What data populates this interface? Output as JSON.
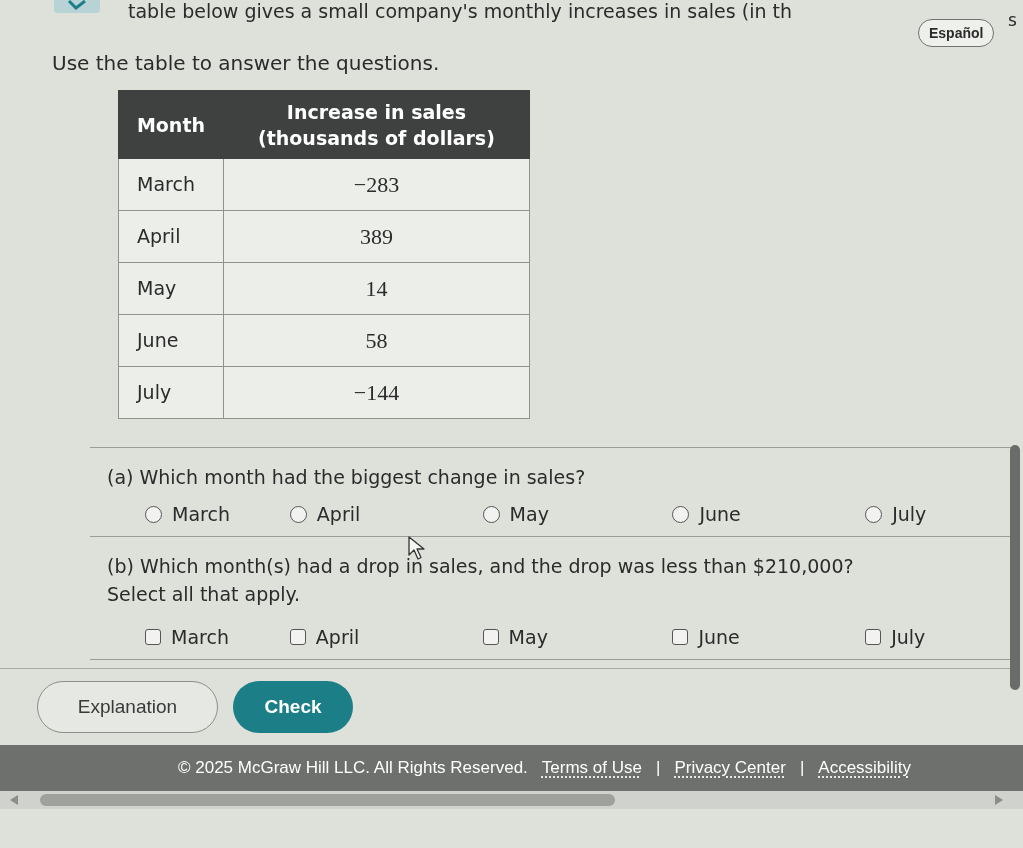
{
  "header": {
    "intro_tail": "table below gives a small company's monthly increases in sales (in th",
    "intro_end": "s",
    "language_button": "Español",
    "instruction": "Use the table to answer the questions."
  },
  "table": {
    "columns": [
      "Month",
      "Increase in sales (thousands of dollars)"
    ],
    "rows": [
      {
        "month": "March",
        "increase": "−283"
      },
      {
        "month": "April",
        "increase": "389"
      },
      {
        "month": "May",
        "increase": "14"
      },
      {
        "month": "June",
        "increase": "58"
      },
      {
        "month": "July",
        "increase": "−144"
      }
    ]
  },
  "questions": [
    {
      "kind": "radio",
      "prompt": "(a) Which month had the biggest change in sales?",
      "options": [
        {
          "label": "March",
          "selected": false
        },
        {
          "label": "April",
          "selected": false
        },
        {
          "label": "May",
          "selected": false
        },
        {
          "label": "June",
          "selected": false
        },
        {
          "label": "July",
          "selected": false
        }
      ]
    },
    {
      "kind": "checkbox",
      "prompt": "(b) Which month(s) had a drop in sales, and the drop was less than $210,000?",
      "instruction": "Select all that apply.",
      "options": [
        {
          "label": "March",
          "checked": false
        },
        {
          "label": "April",
          "checked": false
        },
        {
          "label": "May",
          "checked": false
        },
        {
          "label": "June",
          "checked": false
        },
        {
          "label": "July",
          "checked": false
        }
      ]
    }
  ],
  "buttons": [
    {
      "label": "Explanation",
      "kind": "secondary"
    },
    {
      "label": "Check",
      "kind": "primary"
    }
  ],
  "footer": {
    "copyright": "© 2025 McGraw Hill LLC. All Rights Reserved.",
    "links": [
      "Terms of Use",
      "Privacy Center",
      "Accessibility"
    ],
    "separators": [
      "|",
      "|"
    ]
  }
}
